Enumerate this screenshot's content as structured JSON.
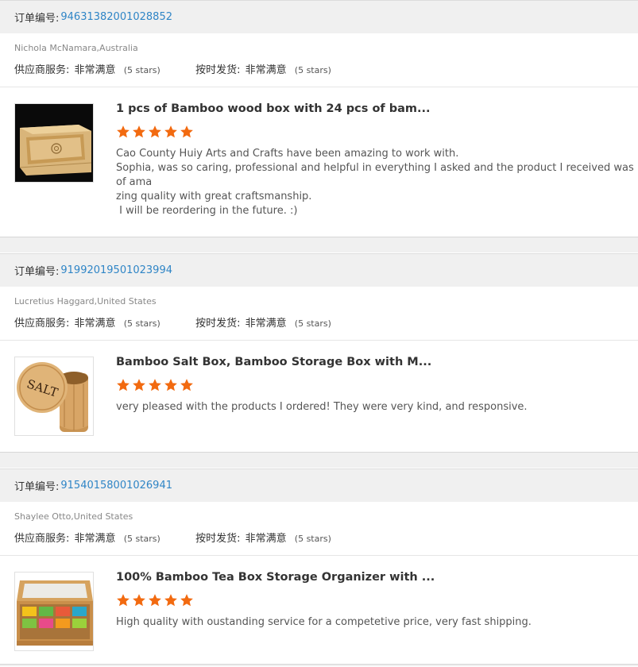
{
  "order_label": "订单编号:",
  "supplier_label": "供应商服务:",
  "shipping_label": "按时发货:",
  "reviews": [
    {
      "order_no": "94631382001028852",
      "buyer": "Nichola McNamara,Australia",
      "supplier_rating": "非常满意",
      "supplier_stars": "(5 stars)",
      "shipping_rating": "非常满意",
      "shipping_stars": "(5 stars)",
      "product_title": "1 pcs of Bamboo wood box with 24 pcs of bam...",
      "star_count": 5,
      "comment": "Cao County Huiy Arts and Crafts have been amazing to work with.\nSophia, was so caring, professional and helpful in everything I asked and the product I received was of ama\nzing quality with great craftsmanship.\n I will be reordering in the future. :)"
    },
    {
      "order_no": "91992019501023994",
      "buyer": "Lucretius Haggard,United States",
      "supplier_rating": "非常满意",
      "supplier_stars": "(5 stars)",
      "shipping_rating": "非常满意",
      "shipping_stars": "(5 stars)",
      "product_title": "Bamboo Salt Box, Bamboo Storage Box with M...",
      "star_count": 5,
      "comment": "very pleased with the products I ordered! They were very kind, and responsive.",
      "thumb_text": "SALT"
    },
    {
      "order_no": "91540158001026941",
      "buyer": "Shaylee Otto,United States",
      "supplier_rating": "非常满意",
      "supplier_stars": "(5 stars)",
      "shipping_rating": "非常满意",
      "shipping_stars": "(5 stars)",
      "product_title": "100% Bamboo Tea Box Storage Organizer with ...",
      "star_count": 5,
      "comment": "High quality with oustanding service for a competetive price, very fast shipping."
    }
  ],
  "colors": {
    "star": "#f26a10",
    "order_no": "#2f85c6"
  },
  "icons": {
    "star": "star-icon"
  }
}
